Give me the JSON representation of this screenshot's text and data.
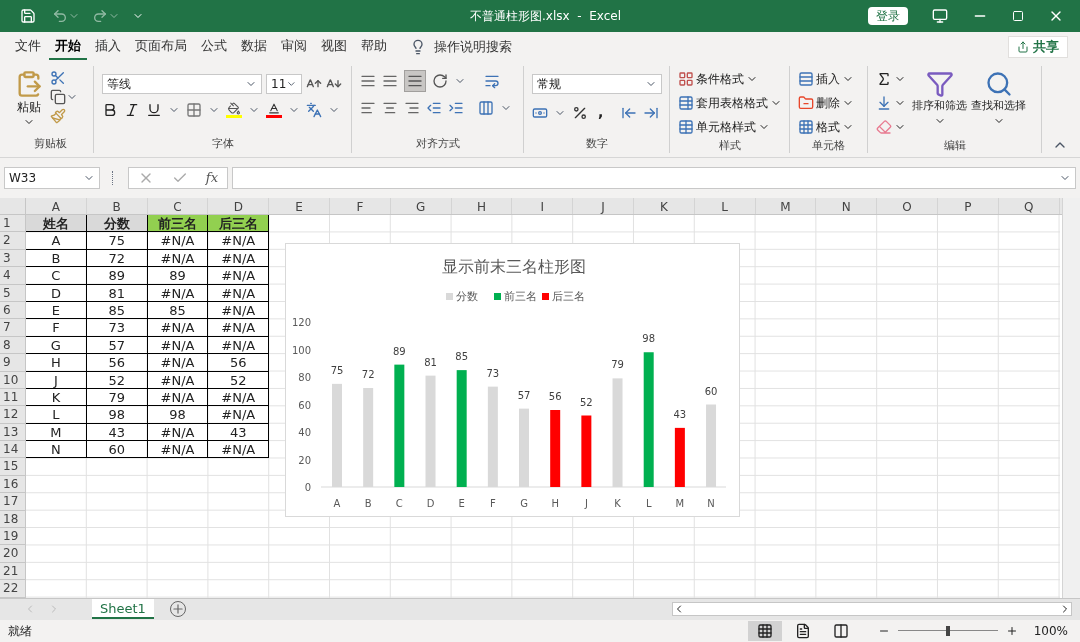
{
  "window": {
    "title": "不普通柱形图.xlsx  -  Excel",
    "login": "登录"
  },
  "menu_tabs": [
    {
      "label": "文件",
      "selected": false
    },
    {
      "label": "开始",
      "selected": true
    },
    {
      "label": "插入",
      "selected": false
    },
    {
      "label": "页面布局",
      "selected": false
    },
    {
      "label": "公式",
      "selected": false
    },
    {
      "label": "数据",
      "selected": false
    },
    {
      "label": "审阅",
      "selected": false
    },
    {
      "label": "视图",
      "selected": false
    },
    {
      "label": "帮助",
      "selected": false
    }
  ],
  "tell_me": "操作说明搜索",
  "share": "共享",
  "ribbon": {
    "clipboard": {
      "label": "剪贴板",
      "paste": "粘贴"
    },
    "font": {
      "label": "字体",
      "font_name": "等线",
      "font_size": "11"
    },
    "alignment": {
      "label": "对齐方式"
    },
    "number": {
      "label": "数字",
      "format": "常规",
      "comma": ","
    },
    "styles": {
      "label": "样式",
      "buttons": [
        "条件格式",
        "套用表格格式",
        "单元格样式"
      ]
    },
    "cells": {
      "label": "单元格",
      "buttons": [
        "插入",
        "删除",
        "格式"
      ]
    },
    "editing": {
      "label": "编辑",
      "buttons": [
        "排序和筛选",
        "查找和选择"
      ]
    }
  },
  "name_box": "W33",
  "function_label": "fx",
  "columns": [
    "A",
    "B",
    "C",
    "D",
    "E",
    "F",
    "G",
    "H",
    "I",
    "J",
    "K",
    "L",
    "M",
    "N",
    "O",
    "P",
    "Q"
  ],
  "row_numbers": [
    "1",
    "2",
    "3",
    "4",
    "5",
    "6",
    "7",
    "8",
    "9",
    "10",
    "11",
    "12",
    "13",
    "14",
    "15",
    "16",
    "17",
    "18",
    "19",
    "20",
    "21",
    "22"
  ],
  "table": {
    "header": [
      {
        "text": "姓名",
        "color": "#d9d9d9"
      },
      {
        "text": "分数",
        "color": "#d9d9d9"
      },
      {
        "text": "前三名",
        "color": "#92d050"
      },
      {
        "text": "后三名",
        "color": "#92d050"
      }
    ],
    "rows": [
      [
        "A",
        "75",
        "#N/A",
        "#N/A"
      ],
      [
        "B",
        "72",
        "#N/A",
        "#N/A"
      ],
      [
        "C",
        "89",
        "89",
        "#N/A"
      ],
      [
        "D",
        "81",
        "#N/A",
        "#N/A"
      ],
      [
        "E",
        "85",
        "85",
        "#N/A"
      ],
      [
        "F",
        "73",
        "#N/A",
        "#N/A"
      ],
      [
        "G",
        "57",
        "#N/A",
        "#N/A"
      ],
      [
        "H",
        "56",
        "#N/A",
        "56"
      ],
      [
        "J",
        "52",
        "#N/A",
        "52"
      ],
      [
        "K",
        "79",
        "#N/A",
        "#N/A"
      ],
      [
        "L",
        "98",
        "98",
        "#N/A"
      ],
      [
        "M",
        "43",
        "#N/A",
        "43"
      ],
      [
        "N",
        "60",
        "#N/A",
        "#N/A"
      ]
    ]
  },
  "chart": {
    "chart_data": {
      "type": "bar",
      "title": "显示前末三名柱形图",
      "categories": [
        "A",
        "B",
        "C",
        "D",
        "E",
        "F",
        "G",
        "H",
        "J",
        "K",
        "L",
        "M",
        "N"
      ],
      "series": [
        {
          "name": "分数",
          "color": "#d9d9d9",
          "values": [
            75,
            72,
            null,
            81,
            null,
            73,
            57,
            null,
            null,
            79,
            null,
            null,
            60
          ]
        },
        {
          "name": "前三名",
          "color": "#00b050",
          "values": [
            null,
            null,
            89,
            null,
            85,
            null,
            null,
            null,
            null,
            null,
            98,
            null,
            null
          ]
        },
        {
          "name": "后三名",
          "color": "#ff0000",
          "values": [
            null,
            null,
            null,
            null,
            null,
            null,
            null,
            56,
            52,
            null,
            null,
            43,
            null
          ]
        }
      ],
      "legend": "top",
      "ylim": [
        0,
        120
      ],
      "yticks": [
        0,
        20,
        40,
        60,
        80,
        100,
        120
      ],
      "data_labels": true
    }
  },
  "sheet_tabs": [
    {
      "label": "Sheet1",
      "selected": true
    }
  ],
  "status": "就绪",
  "view_buttons": [
    {
      "kind": "normal",
      "selected": true
    },
    {
      "kind": "layout",
      "selected": false
    },
    {
      "kind": "pagebreak",
      "selected": false
    }
  ],
  "zoom": {
    "level": 0.5,
    "reading": "100%"
  }
}
